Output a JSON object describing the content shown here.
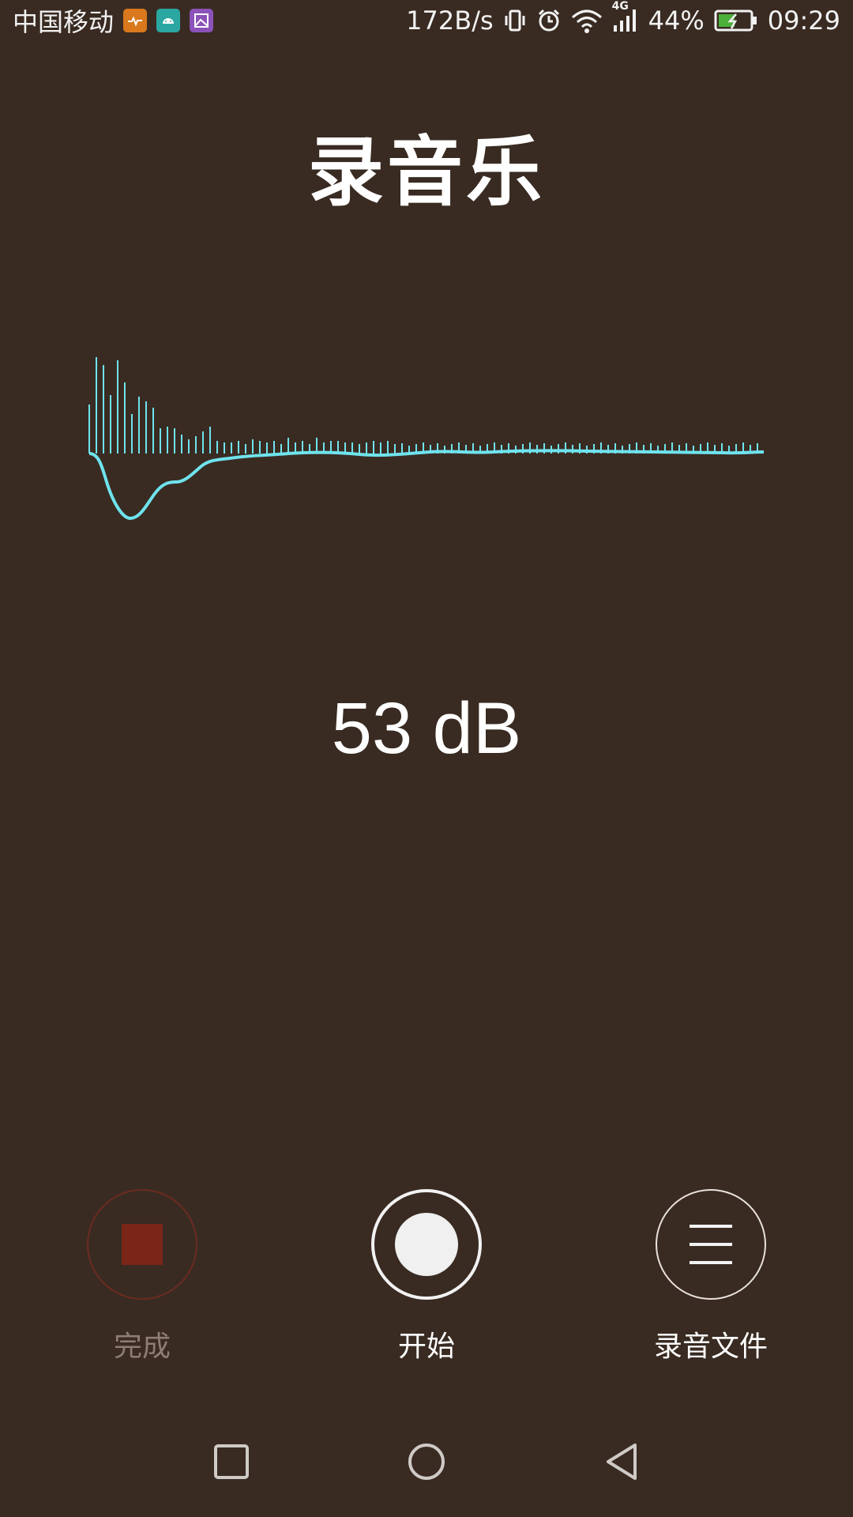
{
  "statusbar": {
    "carrier": "中国移动",
    "speed": "172B/s",
    "network_type": "4G",
    "battery": "44%",
    "time": "09:29",
    "icons": [
      "health-app-icon",
      "android-app-icon",
      "gallery-app-icon",
      "vibrate-icon",
      "alarm-icon",
      "wifi-icon",
      "signal-icon",
      "battery-icon"
    ]
  },
  "app": {
    "title": "录音乐",
    "level": "53 dB"
  },
  "controls": {
    "done_label": "完成",
    "start_label": "开始",
    "files_label": "录音文件"
  },
  "colors": {
    "background": "#392b22",
    "waveform": "#6fe3ee",
    "stop": "#7b2418"
  },
  "navbar": {
    "icons": [
      "recents-icon",
      "home-icon",
      "back-icon"
    ]
  }
}
